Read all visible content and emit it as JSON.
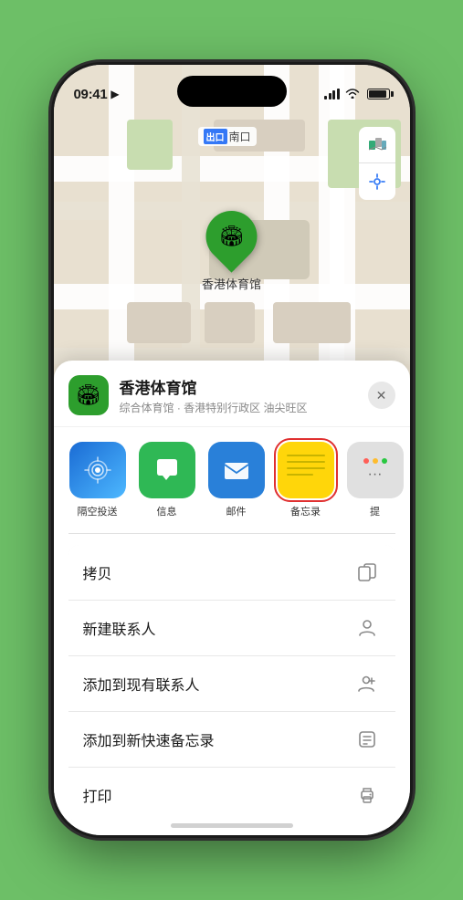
{
  "status_bar": {
    "time": "09:41",
    "location_arrow": "▶"
  },
  "map": {
    "label_tag": "出口",
    "label_text": "南口",
    "marker_label": "香港体育馆",
    "marker_emoji": "🏟"
  },
  "map_controls": {
    "map_icon": "🗺",
    "location_icon": "◎"
  },
  "venue": {
    "icon": "🏟",
    "name": "香港体育馆",
    "subtitle": "综合体育馆 · 香港特别行政区 油尖旺区",
    "close_label": "✕"
  },
  "actions": [
    {
      "id": "airdrop",
      "label": "隔空投送",
      "type": "airdrop"
    },
    {
      "id": "messages",
      "label": "信息",
      "type": "messages"
    },
    {
      "id": "mail",
      "label": "邮件",
      "type": "mail"
    },
    {
      "id": "notes",
      "label": "备忘录",
      "type": "notes",
      "selected": true
    },
    {
      "id": "more",
      "label": "提",
      "type": "more"
    }
  ],
  "menu_items": [
    {
      "id": "copy",
      "label": "拷贝",
      "icon": "copy"
    },
    {
      "id": "new-contact",
      "label": "新建联系人",
      "icon": "person"
    },
    {
      "id": "add-contact",
      "label": "添加到现有联系人",
      "icon": "person-add"
    },
    {
      "id": "quick-note",
      "label": "添加到新快速备忘录",
      "icon": "note"
    },
    {
      "id": "print",
      "label": "打印",
      "icon": "print"
    }
  ]
}
